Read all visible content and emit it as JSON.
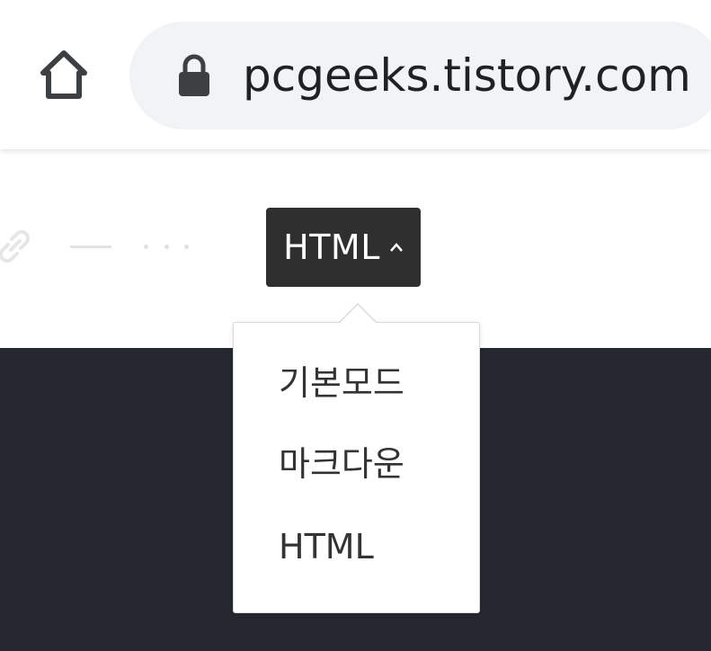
{
  "browser": {
    "url": "pcgeeks.tistory.com"
  },
  "editor": {
    "mode_button_label": "HTML",
    "mode_menu": {
      "items": [
        "기본모드",
        "마크다운",
        "HTML"
      ]
    }
  }
}
